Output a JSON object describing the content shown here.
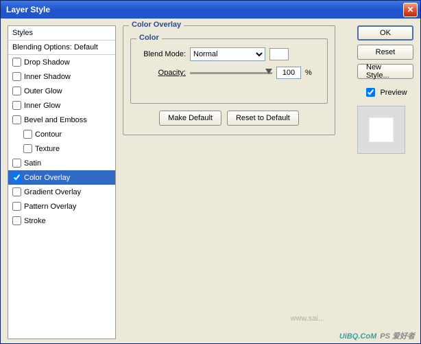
{
  "window": {
    "title": "Layer Style"
  },
  "styles": {
    "header": "Styles",
    "subheader": "Blending Options: Default",
    "items": [
      {
        "label": "Drop Shadow",
        "checked": false,
        "indent": false,
        "selected": false
      },
      {
        "label": "Inner Shadow",
        "checked": false,
        "indent": false,
        "selected": false
      },
      {
        "label": "Outer Glow",
        "checked": false,
        "indent": false,
        "selected": false
      },
      {
        "label": "Inner Glow",
        "checked": false,
        "indent": false,
        "selected": false
      },
      {
        "label": "Bevel and Emboss",
        "checked": false,
        "indent": false,
        "selected": false
      },
      {
        "label": "Contour",
        "checked": false,
        "indent": true,
        "selected": false
      },
      {
        "label": "Texture",
        "checked": false,
        "indent": true,
        "selected": false
      },
      {
        "label": "Satin",
        "checked": false,
        "indent": false,
        "selected": false
      },
      {
        "label": "Color Overlay",
        "checked": true,
        "indent": false,
        "selected": true
      },
      {
        "label": "Gradient Overlay",
        "checked": false,
        "indent": false,
        "selected": false
      },
      {
        "label": "Pattern Overlay",
        "checked": false,
        "indent": false,
        "selected": false
      },
      {
        "label": "Stroke",
        "checked": false,
        "indent": false,
        "selected": false
      }
    ]
  },
  "main": {
    "group_title": "Color Overlay",
    "color_group": "Color",
    "blend_mode_label": "Blend Mode:",
    "blend_mode_value": "Normal",
    "opacity_label": "Opacity:",
    "opacity_value": "100",
    "opacity_unit": "%",
    "make_default": "Make Default",
    "reset_default": "Reset to Default"
  },
  "right": {
    "ok": "OK",
    "reset": "Reset",
    "new_style": "New Style...",
    "preview_label": "Preview",
    "preview_checked": true
  },
  "watermark": {
    "main": "UiBQ.CoM",
    "sub": "PS 爱好者"
  },
  "watermark2": "www.sai..."
}
